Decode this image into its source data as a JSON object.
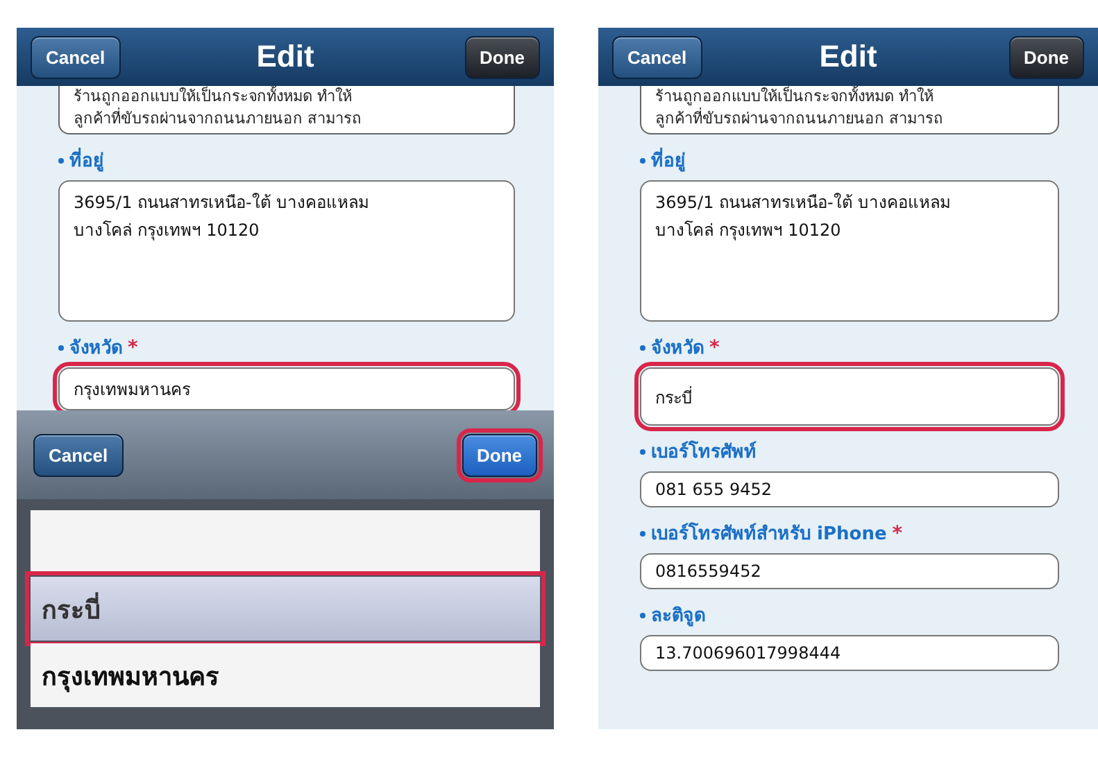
{
  "screens": [
    {
      "nav": {
        "title": "Edit",
        "buttons": [
          {
            "label": "Cancel",
            "kind": "cancel"
          },
          {
            "label": "Done",
            "kind": "dark"
          }
        ]
      },
      "description_lines": [
        "ร้านถูกออกแบบให้เป็นกระจกทั้งหมด ทำให้",
        "ลูกค้าที่ขับรถผ่านจากถนนภายนอก สามารถ"
      ],
      "fields": [
        {
          "kind": "textarea",
          "label": "ที่อยู่",
          "value": "3695/1  ถนนสาทรเหนือ-ใต้ บางคอแหลม\nบางโคล่ กรุงเทพฯ 10120",
          "highlighted": false
        },
        {
          "kind": "text",
          "label": "จังหวัด",
          "required_mark": "*",
          "value": "กรุงเทพมหานคร",
          "highlighted": true
        }
      ],
      "picker": {
        "buttons": [
          {
            "label": "Cancel",
            "kind": "cancel",
            "highlighted": false
          },
          {
            "label": "Done",
            "kind": "primary",
            "highlighted": true
          }
        ],
        "rows": [
          {
            "label": "",
            "selected": false,
            "highlighted": false
          },
          {
            "label": "กระบี่",
            "selected": true,
            "highlighted": true
          },
          {
            "label": "กรุงเทพมหานคร",
            "selected": false,
            "highlighted": false
          }
        ]
      }
    },
    {
      "nav": {
        "title": "Edit",
        "buttons": [
          {
            "label": "Cancel",
            "kind": "cancel"
          },
          {
            "label": "Done",
            "kind": "dark"
          }
        ]
      },
      "description_lines": [
        "ร้านถูกออกแบบให้เป็นกระจกทั้งหมด ทำให้",
        "ลูกค้าที่ขับรถผ่านจากถนนภายนอก สามารถ"
      ],
      "fields": [
        {
          "kind": "textarea",
          "label": "ที่อยู่",
          "value": "3695/1  ถนนสาทรเหนือ-ใต้ บางคอแหลม\nบางโคล่ กรุงเทพฯ 10120",
          "highlighted": false
        },
        {
          "kind": "tall",
          "label": "จังหวัด",
          "required_mark": "*",
          "value": "กระบี่",
          "highlighted": true
        },
        {
          "kind": "text",
          "label": "เบอร์โทรศัพท์",
          "value": "081 655 9452",
          "highlighted": false
        },
        {
          "kind": "text",
          "label": "เบอร์โทรศัพท์สำหรับ iPhone",
          "required_mark": "*",
          "value": "0816559452",
          "highlighted": false
        },
        {
          "kind": "text",
          "label": "ละติจูด",
          "value": "13.700696017998444",
          "highlighted": false
        }
      ]
    }
  ]
}
